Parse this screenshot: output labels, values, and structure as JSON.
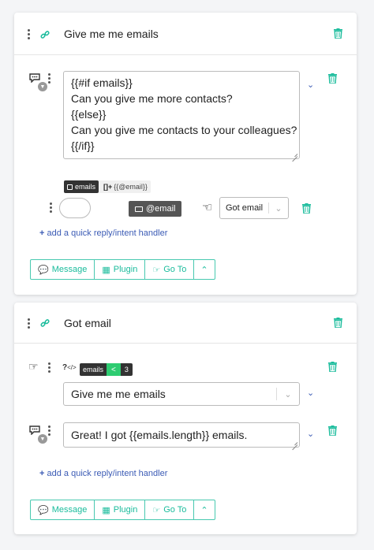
{
  "card1": {
    "title": "Give me me emails",
    "message_text": "{{#if emails}}\nCan you give me more contacts?\n{{else}}\nCan you give me contacts to your colleagues?\n{{/if}}",
    "save_badge": "emails",
    "array_badge_prefix": "[]+",
    "array_badge_value": "{{@email}}",
    "entity_chip": "@email",
    "intent_select": "Got email",
    "quick_reply_label": "add a quick reply/intent handler",
    "buttons": {
      "message": "Message",
      "plugin": "Plugin",
      "goto": "Go To"
    }
  },
  "card2": {
    "title": "Got email",
    "condition_var": "emails",
    "condition_op": "<",
    "condition_val": "3",
    "goto_select": "Give me me emails",
    "message_text": "Great! I got {{emails.length}} emails.",
    "quick_reply_label": "add a quick reply/intent handler",
    "buttons": {
      "message": "Message",
      "plugin": "Plugin",
      "goto": "Go To"
    }
  },
  "colors": {
    "accent": "#1abc9c",
    "link": "#3b5bb5",
    "dark_badge": "#333333",
    "chip": "#555555"
  }
}
